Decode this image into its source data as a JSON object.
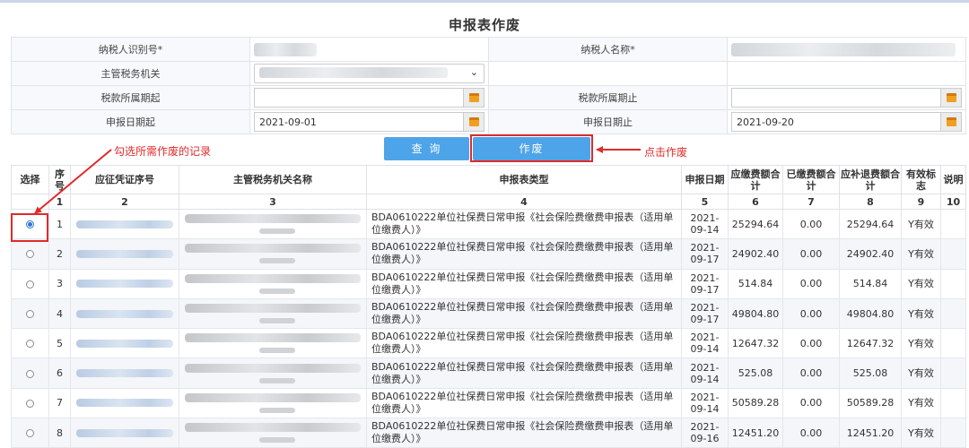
{
  "page_title": "申报表作废",
  "form": {
    "taxpayer_id_label": "纳税人识别号*",
    "taxpayer_name_label": "纳税人名称*",
    "tax_authority_label": "主管税务机关",
    "tax_period_start_label": "税款所属期起",
    "tax_period_end_label": "税款所属期止",
    "declare_date_start_label": "申报日期起",
    "declare_date_start_value": "2021-09-01",
    "declare_date_end_label": "申报日期止",
    "declare_date_end_value": "2021-09-20"
  },
  "buttons": {
    "query": "查 询",
    "void": "作废"
  },
  "annotations": {
    "select_records": "勾选所需作废的记录",
    "click_void": "点击作废"
  },
  "colors": {
    "button_blue": "#4ea4e8",
    "annotation_red": "#e02a2a",
    "radio_blue": "#2a76d2"
  },
  "icons": [
    "calendar-icon",
    "chevron-down-icon",
    "radio-button"
  ],
  "table": {
    "headers": [
      "选择",
      "序号",
      "应征凭证序号",
      "主管税务机关名称",
      "申报表类型",
      "申报日期",
      "应缴费额合计",
      "已缴费额合计",
      "应补退费额合计",
      "有效标志",
      "说明"
    ],
    "col_numbers": [
      "",
      "1",
      "2",
      "3",
      "4",
      "5",
      "6",
      "7",
      "8",
      "9",
      "10"
    ],
    "rows": [
      {
        "seq": "1",
        "type": "BDA0610222单位社保费日常申报《社会保险费缴费申报表（适用单位缴费人）》",
        "date": "2021-09-14",
        "due": "25294.64",
        "paid": "0.00",
        "refund": "25294.64",
        "valid": "Y有效",
        "checked": true
      },
      {
        "seq": "2",
        "type": "BDA0610222单位社保费日常申报《社会保险费缴费申报表（适用单位缴费人）》",
        "date": "2021-09-17",
        "due": "24902.40",
        "paid": "0.00",
        "refund": "24902.40",
        "valid": "Y有效",
        "checked": false
      },
      {
        "seq": "3",
        "type": "BDA0610222单位社保费日常申报《社会保险费缴费申报表（适用单位缴费人）》",
        "date": "2021-09-17",
        "due": "514.84",
        "paid": "0.00",
        "refund": "514.84",
        "valid": "Y有效",
        "checked": false
      },
      {
        "seq": "4",
        "type": "BDA0610222单位社保费日常申报《社会保险费缴费申报表（适用单位缴费人）》",
        "date": "2021-09-17",
        "due": "49804.80",
        "paid": "0.00",
        "refund": "49804.80",
        "valid": "Y有效",
        "checked": false
      },
      {
        "seq": "5",
        "type": "BDA0610222单位社保费日常申报《社会保险费缴费申报表（适用单位缴费人）》",
        "date": "2021-09-14",
        "due": "12647.32",
        "paid": "0.00",
        "refund": "12647.32",
        "valid": "Y有效",
        "checked": false
      },
      {
        "seq": "6",
        "type": "BDA0610222单位社保费日常申报《社会保险费缴费申报表（适用单位缴费人）》",
        "date": "2021-09-14",
        "due": "525.08",
        "paid": "0.00",
        "refund": "525.08",
        "valid": "Y有效",
        "checked": false
      },
      {
        "seq": "7",
        "type": "BDA0610222单位社保费日常申报《社会保险费缴费申报表（适用单位缴费人）》",
        "date": "2021-09-14",
        "due": "50589.28",
        "paid": "0.00",
        "refund": "50589.28",
        "valid": "Y有效",
        "checked": false
      },
      {
        "seq": "8",
        "type": "BDA0610222单位社保费日常申报《社会保险费缴费申报表（适用单位缴费人）》",
        "date": "2021-09-16",
        "due": "12451.20",
        "paid": "0.00",
        "refund": "12451.20",
        "valid": "Y有效",
        "checked": false
      }
    ]
  }
}
